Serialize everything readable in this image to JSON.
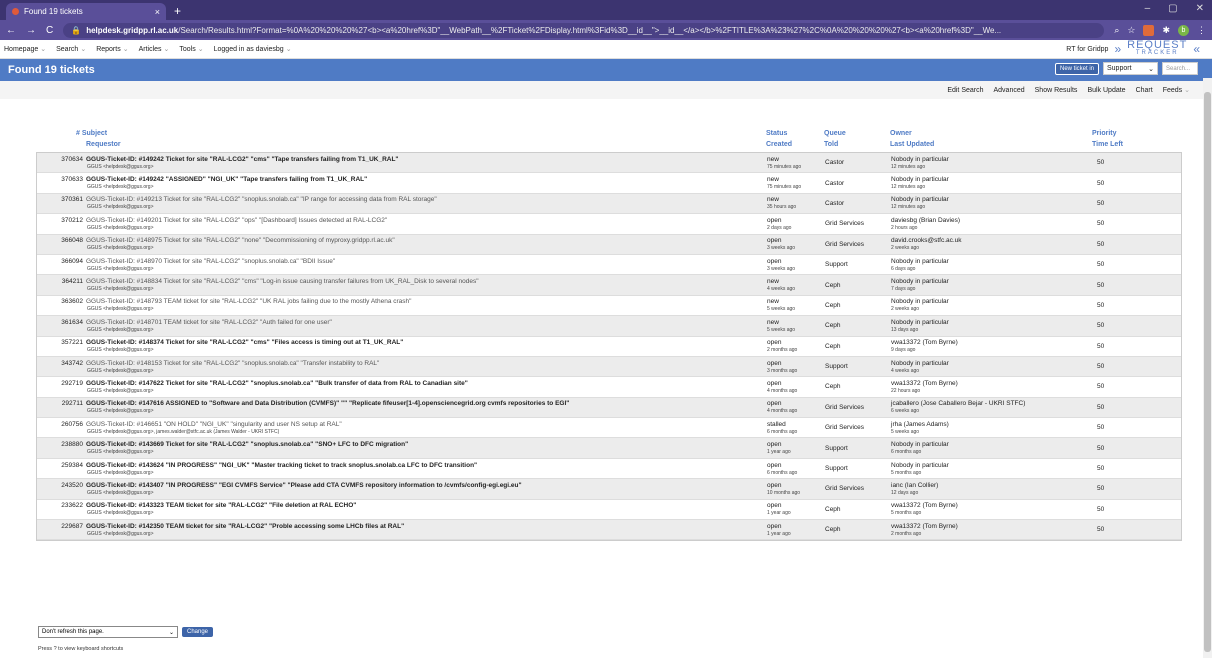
{
  "browser": {
    "tab_title": "Found 19 tickets",
    "tab_close": "×",
    "new_tab": "+",
    "url_host": "helpdesk.gridpp.rl.ac.uk",
    "url_rest": "/Search/Results.html?Format=%0A%20%20%20%27<b><a%20href%3D\"__WebPath__%2FTicket%2FDisplay.html%3Fid%3D__id__\">__id__</a></b>%2FTITLE%3A%23%27%2C%0A%20%20%20%27<b><a%20href%3D\"__We...",
    "avatar_letter": "b",
    "win_min": "–",
    "win_max": "▢",
    "win_close": "✕"
  },
  "menu": {
    "items": [
      "Homepage",
      "Search",
      "Reports",
      "Articles",
      "Tools",
      "Logged in as daviesbg"
    ],
    "rt_for": "RT for Gridpp",
    "logo_top": "REQUEST",
    "logo_bottom": "TRACKER"
  },
  "title": {
    "text": "Found 19 tickets",
    "new_ticket_label": "New ticket in",
    "queue_selected": "Support",
    "search_placeholder": "Search..."
  },
  "page_menu": [
    "Edit Search",
    "Advanced",
    "Show Results",
    "Bulk Update",
    "Chart",
    "Feeds"
  ],
  "columns": {
    "num": "#",
    "subject": "Subject",
    "requestor": "Requestor",
    "status": "Status",
    "created": "Created",
    "queue": "Queue",
    "told": "Told",
    "owner": "Owner",
    "last_updated": "Last Updated",
    "priority": "Priority",
    "time_left": "Time Left"
  },
  "tickets": [
    {
      "id": "370634",
      "subject": "GGUS-Ticket-ID: #149242 Ticket for site \"RAL-LCG2\" \"cms\" \"Tape transfers failing from T1_UK_RAL\"",
      "requestor": "GGUS <helpdesk@ggus.org>",
      "status": "new",
      "created": "75 minutes ago",
      "queue": "Castor",
      "owner": "Nobody in particular",
      "updated": "12 minutes ago",
      "priority": "50"
    },
    {
      "id": "370633",
      "subject": "GGUS-Ticket-ID: #149242 \"ASSIGNED\" \"NGI_UK\" \"Tape transfers failing from T1_UK_RAL\"",
      "requestor": "GGUS <helpdesk@ggus.org>",
      "status": "new",
      "created": "75 minutes ago",
      "queue": "Castor",
      "owner": "Nobody in particular",
      "updated": "12 minutes ago",
      "priority": "50"
    },
    {
      "id": "370361",
      "subject": "GGUS-Ticket-ID: #149213 Ticket for site \"RAL-LCG2\" \"snoplus.snolab.ca\" \"IP range for accessing data from RAL storage\"",
      "requestor": "GGUS <helpdesk@ggus.org>",
      "status": "new",
      "created": "35 hours ago",
      "queue": "Castor",
      "owner": "Nobody in particular",
      "updated": "12 minutes ago",
      "priority": "50"
    },
    {
      "id": "370212",
      "subject": "GGUS-Ticket-ID: #149201 Ticket for site \"RAL-LCG2\" \"ops\" \"[Dashboard] Issues detected at RAL-LCG2\"",
      "requestor": "GGUS <helpdesk@ggus.org>",
      "status": "open",
      "created": "2 days ago",
      "queue": "Grid Services",
      "owner": "daviesbg (Brian Davies)",
      "updated": "2 hours ago",
      "priority": "50"
    },
    {
      "id": "366048",
      "subject": "GGUS-Ticket-ID: #148975 Ticket for site \"RAL-LCG2\" \"none\" \"Decommissioning of myproxy.gridpp.rl.ac.uk\"",
      "requestor": "GGUS <helpdesk@ggus.org>",
      "status": "open",
      "created": "3 weeks ago",
      "queue": "Grid Services",
      "owner": "david.crooks@stfc.ac.uk",
      "updated": "2 weeks ago",
      "priority": "50"
    },
    {
      "id": "366094",
      "subject": "GGUS-Ticket-ID: #148970 Ticket for site \"RAL-LCG2\" \"snoplus.snolab.ca\" \"BDII Issue\"",
      "requestor": "GGUS <helpdesk@ggus.org>",
      "status": "open",
      "created": "3 weeks ago",
      "queue": "Support",
      "owner": "Nobody in particular",
      "updated": "6 days ago",
      "priority": "50"
    },
    {
      "id": "364211",
      "subject": "GGUS-Ticket-ID: #148834 Ticket for site \"RAL-LCG2\" \"cms\" \"Log-in issue causing transfer failures from UK_RAL_Disk to several nodes\"",
      "requestor": "GGUS <helpdesk@ggus.org>",
      "status": "new",
      "created": "4 weeks ago",
      "queue": "Ceph",
      "owner": "Nobody in particular",
      "updated": "7 days ago",
      "priority": "50"
    },
    {
      "id": "363602",
      "subject": "GGUS-Ticket-ID: #148793 TEAM ticket for site \"RAL-LCG2\" \"UK RAL jobs failing due to the mostly Athena crash\"",
      "requestor": "GGUS <helpdesk@ggus.org>",
      "status": "new",
      "created": "5 weeks ago",
      "queue": "Ceph",
      "owner": "Nobody in particular",
      "updated": "2 weeks ago",
      "priority": "50"
    },
    {
      "id": "361634",
      "subject": "GGUS-Ticket-ID: #148701 TEAM ticket for site \"RAL-LCG2\" \"Auth failed for one user\"",
      "requestor": "GGUS <helpdesk@ggus.org>",
      "status": "new",
      "created": "5 weeks ago",
      "queue": "Ceph",
      "owner": "Nobody in particular",
      "updated": "13 days ago",
      "priority": "50"
    },
    {
      "id": "357221",
      "subject": "GGUS-Ticket-ID: #148374 Ticket for site \"RAL-LCG2\" \"cms\" \"Files access is timing out at T1_UK_RAL\"",
      "requestor": "GGUS <helpdesk@ggus.org>",
      "status": "open",
      "created": "2 months ago",
      "queue": "Ceph",
      "owner": "vwa13372 (Tom Byrne)",
      "updated": "9 days ago",
      "priority": "50"
    },
    {
      "id": "343742",
      "subject": "GGUS-Ticket-ID: #148153 Ticket for site \"RAL-LCG2\" \"snoplus.snolab.ca\" \"Transfer instability to RAL\"",
      "requestor": "GGUS <helpdesk@ggus.org>",
      "status": "open",
      "created": "3 months ago",
      "queue": "Support",
      "owner": "Nobody in particular",
      "updated": "4 weeks ago",
      "priority": "50"
    },
    {
      "id": "292719",
      "subject": "GGUS-Ticket-ID: #147622 Ticket for site \"RAL-LCG2\" \"snoplus.snolab.ca\" \"Bulk transfer of data from RAL to Canadian site\"",
      "requestor": "GGUS <helpdesk@ggus.org>",
      "status": "open",
      "created": "4 months ago",
      "queue": "Ceph",
      "owner": "vwa13372 (Tom Byrne)",
      "updated": "22 hours ago",
      "priority": "50"
    },
    {
      "id": "292711",
      "subject": "GGUS-Ticket-ID: #147616 ASSIGNED to \"Software and Data Distribution (CVMFS)\" \"\" \"Replicate fifeuser[1-4].opensciencegrid.org cvmfs repositories to EGI\"",
      "requestor": "GGUS <helpdesk@ggus.org>",
      "status": "open",
      "created": "4 months ago",
      "queue": "Grid Services",
      "owner": "jcaballero (Jose Caballero Bejar - UKRI STFC)",
      "updated": "6 weeks ago",
      "priority": "50"
    },
    {
      "id": "260756",
      "subject": "GGUS-Ticket-ID: #146651 \"ON HOLD\" \"NGI_UK\" \"singularity and user NS setup at RAL\"",
      "requestor": "GGUS <helpdesk@ggus.org>, james.walder@stfc.ac.uk (James Walder - UKRI STFC)",
      "status": "stalled",
      "created": "6 months ago",
      "queue": "Grid Services",
      "owner": "jrha (James Adams)",
      "updated": "5 weeks ago",
      "priority": "50"
    },
    {
      "id": "238880",
      "subject": "GGUS-Ticket-ID: #143669 Ticket for site \"RAL-LCG2\" \"snoplus.snolab.ca\" \"SNO+ LFC to DFC migration\"",
      "requestor": "GGUS <helpdesk@ggus.org>",
      "status": "open",
      "created": "1 year ago",
      "queue": "Support",
      "owner": "Nobody in particular",
      "updated": "6 months ago",
      "priority": "50"
    },
    {
      "id": "259384",
      "subject": "GGUS-Ticket-ID: #143624 \"IN PROGRESS\" \"NGI_UK\" \"Master tracking ticket to track snoplus.snolab.ca LFC to DFC transition\"",
      "requestor": "GGUS <helpdesk@ggus.org>",
      "status": "open",
      "created": "6 months ago",
      "queue": "Support",
      "owner": "Nobody in particular",
      "updated": "5 months ago",
      "priority": "50"
    },
    {
      "id": "243520",
      "subject": "GGUS-Ticket-ID: #143407 \"IN PROGRESS\" \"EGI CVMFS Service\" \"Please add CTA CVMFS repository information to /cvmfs/config-egi.egi.eu\"",
      "requestor": "GGUS <helpdesk@ggus.org>",
      "status": "open",
      "created": "10 months ago",
      "queue": "Grid Services",
      "owner": "ianc (Ian Collier)",
      "updated": "12 days ago",
      "priority": "50"
    },
    {
      "id": "233622",
      "subject": "GGUS-Ticket-ID: #143323 TEAM ticket for site \"RAL-LCG2\" \"File deletion at RAL ECHO\"",
      "requestor": "GGUS <helpdesk@ggus.org>",
      "status": "open",
      "created": "1 year ago",
      "queue": "Ceph",
      "owner": "vwa13372 (Tom Byrne)",
      "updated": "5 months ago",
      "priority": "50"
    },
    {
      "id": "229687",
      "subject": "GGUS-Ticket-ID: #142350 TEAM ticket for site \"RAL-LCG2\" \"Proble accessing some LHCb files at RAL\"",
      "requestor": "GGUS <helpdesk@ggus.org>",
      "status": "open",
      "created": "1 year ago",
      "queue": "Ceph",
      "owner": "vwa13372 (Tom Byrne)",
      "updated": "2 months ago",
      "priority": "50"
    }
  ],
  "footer": {
    "refresh_selected": "Don't refresh this page.",
    "change_label": "Change",
    "keyboard_hint": "Press ? to view keyboard shortcuts"
  }
}
